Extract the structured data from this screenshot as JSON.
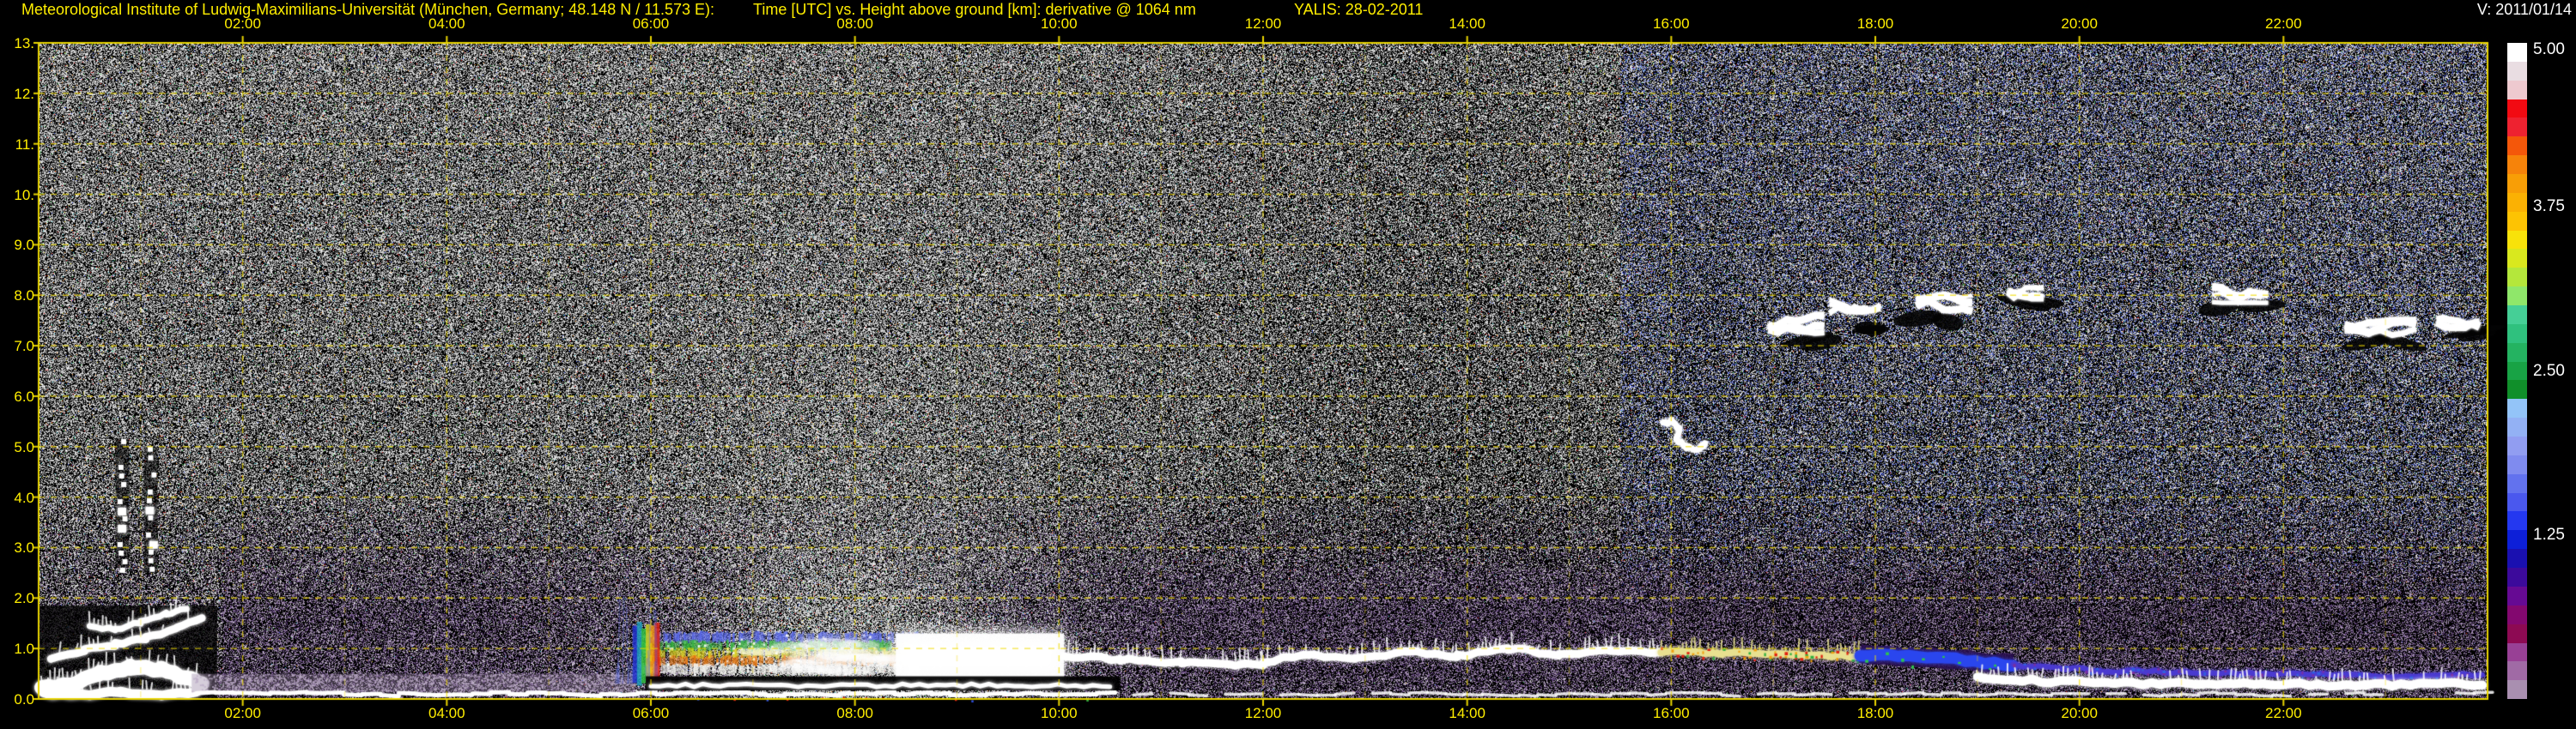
{
  "header": {
    "institute": "Meteorological Institute of Ludwig-Maximilians-Universität (München, Germany; 48.148 N / 11.573 E):",
    "plot_title": "Time [UTC] vs. Height above ground [km]: derivative @ 1064 nm",
    "instrument_date": "YALIS: 28-02-2011",
    "version": "V: 2011/01/14",
    "text_color": "#ffee00",
    "version_color": "#ffffff"
  },
  "chart_data": {
    "type": "heatmap",
    "title": "Time [UTC] vs. Height above ground [km]: derivative @ 1064 nm",
    "xlabel": "Time [UTC]",
    "ylabel": "Height above ground [km]",
    "x_range_hours": [
      0,
      24
    ],
    "y_range_km": [
      0,
      13
    ],
    "x_ticks": [
      {
        "label": "02:00",
        "hour": 2
      },
      {
        "label": "04:00",
        "hour": 4
      },
      {
        "label": "06:00",
        "hour": 6
      },
      {
        "label": "08:00",
        "hour": 8
      },
      {
        "label": "10:00",
        "hour": 10
      },
      {
        "label": "12:00",
        "hour": 12
      },
      {
        "label": "14:00",
        "hour": 14
      },
      {
        "label": "16:00",
        "hour": 16
      },
      {
        "label": "18:00",
        "hour": 18
      },
      {
        "label": "20:00",
        "hour": 20
      },
      {
        "label": "22:00",
        "hour": 22
      }
    ],
    "y_ticks": [
      {
        "label": "13.",
        "km": 13
      },
      {
        "label": "12.",
        "km": 12
      },
      {
        "label": "11.",
        "km": 11
      },
      {
        "label": "10.",
        "km": 10
      },
      {
        "label": "9.0",
        "km": 9
      },
      {
        "label": "8.0",
        "km": 8
      },
      {
        "label": "7.0",
        "km": 7
      },
      {
        "label": "6.0",
        "km": 6
      },
      {
        "label": "5.0",
        "km": 5
      },
      {
        "label": "4.0",
        "km": 4
      },
      {
        "label": "3.0",
        "km": 3
      },
      {
        "label": "2.0",
        "km": 2
      },
      {
        "label": "1.0",
        "km": 1
      },
      {
        "label": "0.0",
        "km": 0
      }
    ],
    "grid": {
      "h_lines_km": [
        1,
        2,
        3,
        4,
        5,
        6,
        7,
        8,
        9,
        10,
        11,
        12
      ],
      "v_lines_hours": [
        1,
        2,
        3,
        4,
        5,
        6,
        7,
        8,
        9,
        10,
        11,
        12,
        13,
        14,
        15,
        16,
        17,
        18,
        19,
        20,
        21,
        22,
        23
      ],
      "color": "#e8d400"
    },
    "colorbar": {
      "range": [
        0,
        5
      ],
      "labels": [
        {
          "text": "5.00",
          "frac": 0.0
        },
        {
          "text": "3.75",
          "frac": 0.25
        },
        {
          "text": "2.50",
          "frac": 0.5
        },
        {
          "text": "1.25",
          "frac": 0.75
        }
      ],
      "colors_top_to_bottom": [
        "#ffffff",
        "#e9dde2",
        "#eec9cf",
        "#f20a12",
        "#ee2230",
        "#f4570a",
        "#f6830a",
        "#f89e06",
        "#fbb103",
        "#fdc303",
        "#f8e20a",
        "#d9e81e",
        "#b4e73b",
        "#8fe76a",
        "#45cf96",
        "#2fc17e",
        "#24b361",
        "#18a345",
        "#108f2a",
        "#93c4f8",
        "#93b1f4",
        "#919df1",
        "#7f8bef",
        "#6272ee",
        "#4a58ee",
        "#2438f0",
        "#0d1fd8",
        "#1a10b0",
        "#3c0a9b",
        "#660a93",
        "#83086f",
        "#8d0a53",
        "#984095",
        "#a06aa5",
        "#a98fb0"
      ]
    },
    "noise": {
      "seed": 987654321,
      "base_density": 0.47,
      "height_gain": 0.1,
      "plume": {
        "center_hour": 7.9,
        "sigma_hour": 1.8,
        "amp": 0.2,
        "height_decay_km": 4.5
      },
      "dark_zone": {
        "center_hour": 13.8,
        "sigma_hour": 2.2,
        "amp": 0.09,
        "min_km": 2.6
      },
      "purple_top_km": 4.3,
      "accent_ratio": 0.04,
      "mauve": "#9c88aa",
      "dark_purple": "#54386e",
      "blue_tint": "#6070d8",
      "accents": [
        "#e62828",
        "#3cc850",
        "#4660f0",
        "#ebe13c",
        "#3cc8d2",
        "#f08c28"
      ]
    },
    "features": {
      "surface_left_stack": [
        {
          "pts": [
            [
              0.03,
              0.22
            ],
            [
              0.3,
              0.28
            ],
            [
              0.6,
              0.5
            ],
            [
              0.9,
              0.62
            ],
            [
              1.2,
              0.58
            ],
            [
              1.45,
              0.42
            ],
            [
              1.6,
              0.28
            ]
          ],
          "w": 17
        },
        {
          "pts": [
            [
              0.05,
              0.1
            ],
            [
              0.4,
              0.08
            ],
            [
              0.8,
              0.14
            ],
            [
              1.2,
              0.09
            ],
            [
              1.55,
              0.12
            ]
          ],
          "w": 11
        },
        {
          "pts": [
            [
              0.12,
              0.82
            ],
            [
              0.45,
              0.97
            ],
            [
              0.75,
              1.08
            ],
            [
              1.05,
              1.2
            ],
            [
              1.35,
              1.42
            ],
            [
              1.6,
              1.62
            ]
          ],
          "w": 9
        },
        {
          "pts": [
            [
              0.5,
              1.45
            ],
            [
              0.75,
              1.38
            ],
            [
              1.0,
              1.52
            ],
            [
              1.25,
              1.68
            ],
            [
              1.45,
              1.78
            ]
          ],
          "w": 7
        }
      ],
      "ground_line": {
        "t": [
          1.55,
          23.95
        ],
        "h": 0.1
      },
      "mauve_band": {
        "t": [
          1.5,
          5.85
        ],
        "h": [
          0.14,
          0.5
        ]
      },
      "cloud_deck": {
        "stripes": {
          "t": [
            5.9,
            8.6
          ],
          "rows": [
            {
              "h": [
                1.12,
                1.32
              ],
              "color": "#5a6aee"
            },
            {
              "h": [
                0.96,
                1.14
              ],
              "color": "#38b53f"
            },
            {
              "h": [
                0.82,
                0.98
              ],
              "color": "#e4d81c"
            },
            {
              "h": [
                0.67,
                0.84
              ],
              "color": "#f07c10"
            },
            {
              "h": [
                0.5,
                0.68
              ],
              "color": "#f5f5f0"
            }
          ]
        },
        "rainbow_edge": {
          "t": [
            5.82,
            6.08
          ],
          "h": [
            0.25,
            1.55
          ],
          "colors": [
            "#2030d0",
            "#20a0c0",
            "#30c040",
            "#d0d020",
            "#f09010",
            "#e02010"
          ]
        },
        "glow_soft": {
          "t": [
            7.0,
            8.45
          ],
          "h": [
            0.5,
            1.1
          ]
        },
        "glow_bright": {
          "t": [
            8.4,
            10.05
          ],
          "h": [
            0.4,
            1.3
          ]
        },
        "black_gap": {
          "t": [
            5.95,
            10.6
          ],
          "h": [
            0.17,
            0.45
          ]
        },
        "second_line": {
          "t": [
            6.0,
            10.5
          ],
          "h": 0.27
        },
        "blue_columns": {
          "t": [
            5.65,
            6.1
          ],
          "h": [
            0.3,
            2.1
          ],
          "count": 14
        }
      },
      "mixed_layer_bands": [
        {
          "pts": [
            [
              10.05,
              0.85
            ],
            [
              10.6,
              0.78
            ],
            [
              11.2,
              0.72
            ],
            [
              12.0,
              0.68
            ]
          ],
          "w": 9,
          "color": "#ffffff",
          "spiky": true
        },
        {
          "pts": [
            [
              12.0,
              0.72
            ],
            [
              12.4,
              0.88
            ],
            [
              12.9,
              0.78
            ],
            [
              13.4,
              0.95
            ],
            [
              13.9,
              0.85
            ],
            [
              14.4,
              1.0
            ],
            [
              14.9,
              0.88
            ],
            [
              15.4,
              0.97
            ],
            [
              15.9,
              0.9
            ]
          ],
          "w": 9,
          "color": "#ffffff",
          "spiky": true
        },
        {
          "pts": [
            [
              15.9,
              0.93
            ],
            [
              16.5,
              0.9
            ],
            [
              17.2,
              0.88
            ],
            [
              17.85,
              0.85
            ]
          ],
          "w": 8,
          "color": "#e8e090",
          "spiky": true,
          "specks": [
            "#e02010",
            "#30b040",
            "#f0a010"
          ]
        },
        {
          "pts": [
            [
              17.85,
              0.88
            ],
            [
              18.6,
              0.82
            ],
            [
              19.35,
              0.68
            ]
          ],
          "w": 13,
          "color": "#2a46ee",
          "top_edge": "#2a1050",
          "specks": [
            "#2ec44e"
          ]
        },
        {
          "pts": [
            [
              19.35,
              0.68
            ],
            [
              20.2,
              0.56
            ],
            [
              21.2,
              0.52
            ],
            [
              22.2,
              0.5
            ],
            [
              23.2,
              0.44
            ],
            [
              23.95,
              0.48
            ]
          ],
          "w": 6,
          "color": "#4a3ad0",
          "specks": [
            "#7a30a0",
            "#3060e0"
          ]
        },
        {
          "pts": [
            [
              19.0,
              0.42
            ],
            [
              19.8,
              0.34
            ],
            [
              20.8,
              0.3
            ],
            [
              21.8,
              0.3
            ],
            [
              22.8,
              0.27
            ],
            [
              23.95,
              0.3
            ]
          ],
          "w": 10,
          "color": "#ffffff",
          "spiky": true
        }
      ],
      "dotted_columns": [
        {
          "t": 0.82,
          "h": [
            2.6,
            5.15
          ]
        },
        {
          "t": 1.1,
          "h": [
            2.5,
            5.0
          ]
        }
      ],
      "squiggle": {
        "pts": [
          [
            15.92,
            5.45
          ],
          [
            16.0,
            5.5
          ],
          [
            16.08,
            5.35
          ],
          [
            16.05,
            5.15
          ],
          [
            16.15,
            5.0
          ],
          [
            16.28,
            4.95
          ],
          [
            16.33,
            5.05
          ]
        ],
        "w": 7
      },
      "mid_clouds": [
        {
          "t": [
            16.95,
            17.5
          ],
          "h": [
            7.25,
            7.6
          ]
        },
        {
          "t": [
            17.55,
            18.05
          ],
          "h": [
            7.45,
            7.95
          ]
        },
        {
          "t": [
            18.4,
            18.95
          ],
          "h": [
            7.6,
            8.0
          ]
        },
        {
          "t": [
            19.3,
            19.65
          ],
          "h": [
            7.95,
            8.15
          ]
        },
        {
          "t": [
            21.3,
            21.85
          ],
          "h": [
            7.85,
            8.2
          ]
        },
        {
          "t": [
            22.6,
            23.3
          ],
          "h": [
            7.15,
            7.5
          ]
        },
        {
          "t": [
            23.5,
            23.92
          ],
          "h": [
            7.35,
            7.6
          ]
        }
      ]
    }
  }
}
